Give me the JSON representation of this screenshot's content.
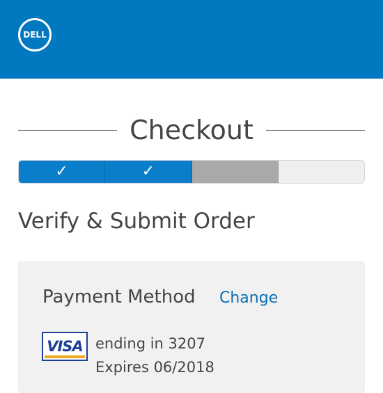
{
  "header": {
    "logo_text": "DELL",
    "logo_icon": "dell-logo",
    "background_color": "#0178c0"
  },
  "checkout": {
    "title": "Checkout",
    "progress": {
      "steps": [
        {
          "state": "completed",
          "icon": "checkmark-icon",
          "glyph": "✓"
        },
        {
          "state": "completed",
          "icon": "checkmark-icon",
          "glyph": "✓"
        },
        {
          "state": "current"
        },
        {
          "state": "upcoming"
        }
      ],
      "completed_color": "#0b7ecb",
      "current_color": "#a9a9a9",
      "upcoming_color": "#efefef"
    },
    "subtitle": "Verify & Submit Order"
  },
  "payment": {
    "title": "Payment Method",
    "change_label": "Change",
    "card_brand": "VISA",
    "ending_text": "ending in 3207",
    "expires_text": "Expires 06/2018",
    "link_color": "#0a6fb3"
  }
}
